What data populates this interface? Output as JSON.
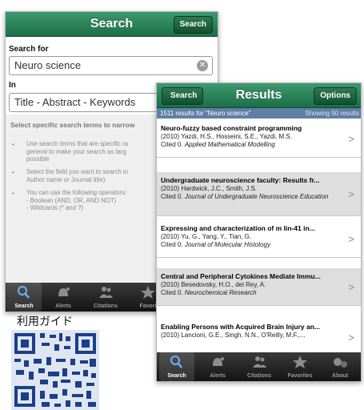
{
  "search_screen": {
    "title": "Search",
    "search_button": "Search",
    "search_for_label": "Search for",
    "search_value": "Neuro science",
    "in_label": "In",
    "in_value": "Title - Abstract - Keywords",
    "help_heading": "Select specific search terms to narrow",
    "help_items": [
      "Use search terms that are specific ra\ngeneral to make your search as targ\npossible",
      "Select the field you want to search in\nAuthor name or Journal title)",
      "You can use the following operators:\n- Boolean (AND, OR, AND NOT)\n- Wildcards (* and ?)"
    ]
  },
  "results_screen": {
    "back_button": "Search",
    "title": "Results",
    "options_button": "Options",
    "count_text": "1511 results for \"Neuro science\"",
    "showing_text": "Showing 50 results",
    "results": [
      {
        "title": "Neuro-fuzzy based constraint programming",
        "authors": "(2010) Yazdi, H.S., Hosseini, S.E., Yazdi, M.S.",
        "cited": "Cited 0.",
        "journal": "Applied Mathematical Modelling"
      },
      {
        "title": "Undergraduate neuroscience faculty: Results fr...",
        "authors": "(2010) Hardwick, J.C., Smith, J.S.",
        "cited": "Cited 0.",
        "journal": "Journal of Undergraduate Neuroscience Education"
      },
      {
        "title": "Expressing and characterization of m lin-41 in...",
        "authors": "(2010) Yu, G., Yang, Y., Tian, G.",
        "cited": "Cited 0.",
        "journal": "Journal of Molecular Histology"
      },
      {
        "title": "Central and Peripheral Cytokines Mediate Immu...",
        "authors": "(2010) Besedovsky, H.O., del Rey, A.",
        "cited": "Cited 0.",
        "journal": "Neurochemical Research"
      },
      {
        "title": "Enabling Persons with Acquired Brain Injury an...",
        "authors": "(2010) Lancioni, G.E., Singh, N.N., O'Reilly, M.F.,...",
        "cited": "",
        "journal": ""
      }
    ]
  },
  "tabbar": {
    "tabs": [
      {
        "label": "Search",
        "icon": "magnifier-icon"
      },
      {
        "label": "Alerts",
        "icon": "alert-bell-icon"
      },
      {
        "label": "Citations",
        "icon": "citations-people-icon"
      },
      {
        "label": "Favorites",
        "icon": "star-icon"
      },
      {
        "label": "About",
        "icon": "about-dots-icon"
      }
    ],
    "search_screen_partial_label": "Favori"
  },
  "guide_label": "利用ガイド",
  "colors": {
    "navbar_green": "#1c6e48",
    "results_header_blue": "#5f7fa6",
    "tabbar_dark": "#1a1a1a",
    "qr_blue": "#1b3f8a"
  }
}
